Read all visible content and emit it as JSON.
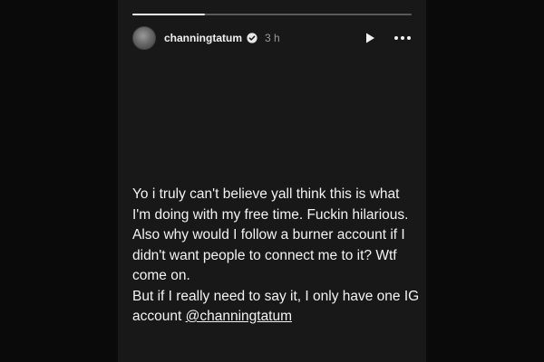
{
  "story": {
    "progress": 0.26,
    "username": "channingtatum",
    "timestamp": "3 h",
    "icons": {
      "avatar": "profile-avatar",
      "verified": "verified-badge-icon",
      "play": "play-icon",
      "more": "more-options-icon"
    },
    "caption": {
      "line1": "Yo i truly can't believe yall think this is what I'm doing with my free time. Fuckin hilarious. Also why would I follow a burner account if I didn't want people to connect me to it? Wtf come on.",
      "line2_prefix": "But if I really need to say it, I only have one IG account ",
      "mention": "@channingtatum"
    }
  }
}
